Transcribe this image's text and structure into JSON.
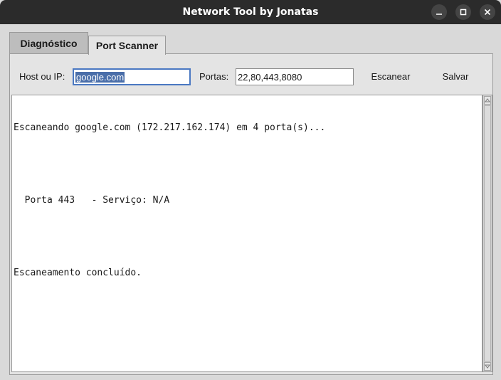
{
  "window": {
    "title": "Network Tool by Jonatas",
    "icons": {
      "minimize": "minimize-icon",
      "maximize": "maximize-icon",
      "close": "close-icon"
    }
  },
  "tabs": [
    {
      "label": "Diagnóstico",
      "active": false
    },
    {
      "label": "Port Scanner",
      "active": true
    }
  ],
  "form": {
    "host_label": "Host ou IP:",
    "host_value": "google.com",
    "ports_label": "Portas:",
    "ports_value": "22,80,443,8080",
    "scan_label": "Escanear",
    "save_label": "Salvar"
  },
  "output": {
    "lines": [
      "Escaneando google.com (172.217.162.174) em 4 porta(s)...",
      "",
      "  Porta 443   - Serviço: N/A",
      "",
      "Escaneamento concluído."
    ]
  },
  "colors": {
    "titlebar": "#2b2b2b",
    "window_bg": "#d9d9d9",
    "selection": "#4a6ea9",
    "focus_border": "#4a78c2"
  }
}
